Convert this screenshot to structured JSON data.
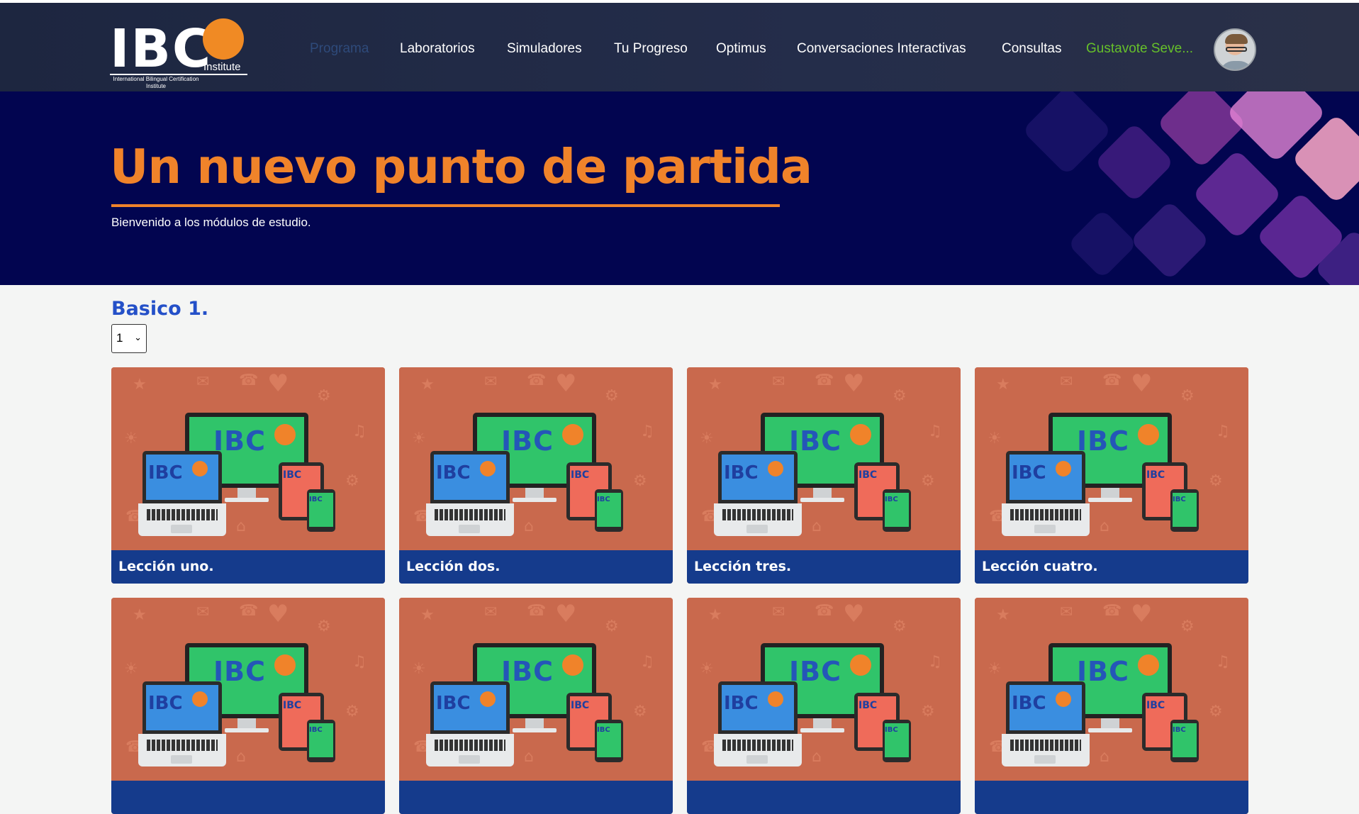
{
  "navbar": {
    "logo": {
      "brand": "IBC",
      "suffix": "Institute",
      "tagline": "International Bilingual Certification Institute"
    },
    "items": [
      {
        "label": "Programa",
        "active": true
      },
      {
        "label": "Laboratorios",
        "active": false
      },
      {
        "label": "Simuladores",
        "active": false
      },
      {
        "label": "Tu Progreso",
        "active": false
      },
      {
        "label": "Optimus",
        "active": false
      },
      {
        "label": "Conversaciones Interactivas",
        "active": false
      },
      {
        "label": "Consultas",
        "active": false
      }
    ],
    "user_name": "Gustavote Seve...",
    "avatar_icon": "user-avatar"
  },
  "hero": {
    "title": "Un nuevo punto de partida",
    "subtitle": "Bienvenido a los módulos de estudio."
  },
  "section": {
    "title": "Basico 1.",
    "select_value": "1"
  },
  "cards": [
    {
      "label": "Lección uno."
    },
    {
      "label": "Lección dos."
    },
    {
      "label": "Lección tres."
    },
    {
      "label": "Lección cuatro."
    },
    {
      "label": ""
    },
    {
      "label": ""
    },
    {
      "label": ""
    },
    {
      "label": ""
    }
  ],
  "card_image": {
    "monitor_text": "IBC",
    "laptop_text": "IBC",
    "tablet_text": "IBC",
    "phone_text": "IBC"
  },
  "colors": {
    "accent_orange": "#f0832a",
    "nav_bg": "#1d2640",
    "hero_bg": "#020550",
    "card_bar": "#153b8c",
    "section_title": "#2450c8",
    "user_green": "#66c02a"
  }
}
